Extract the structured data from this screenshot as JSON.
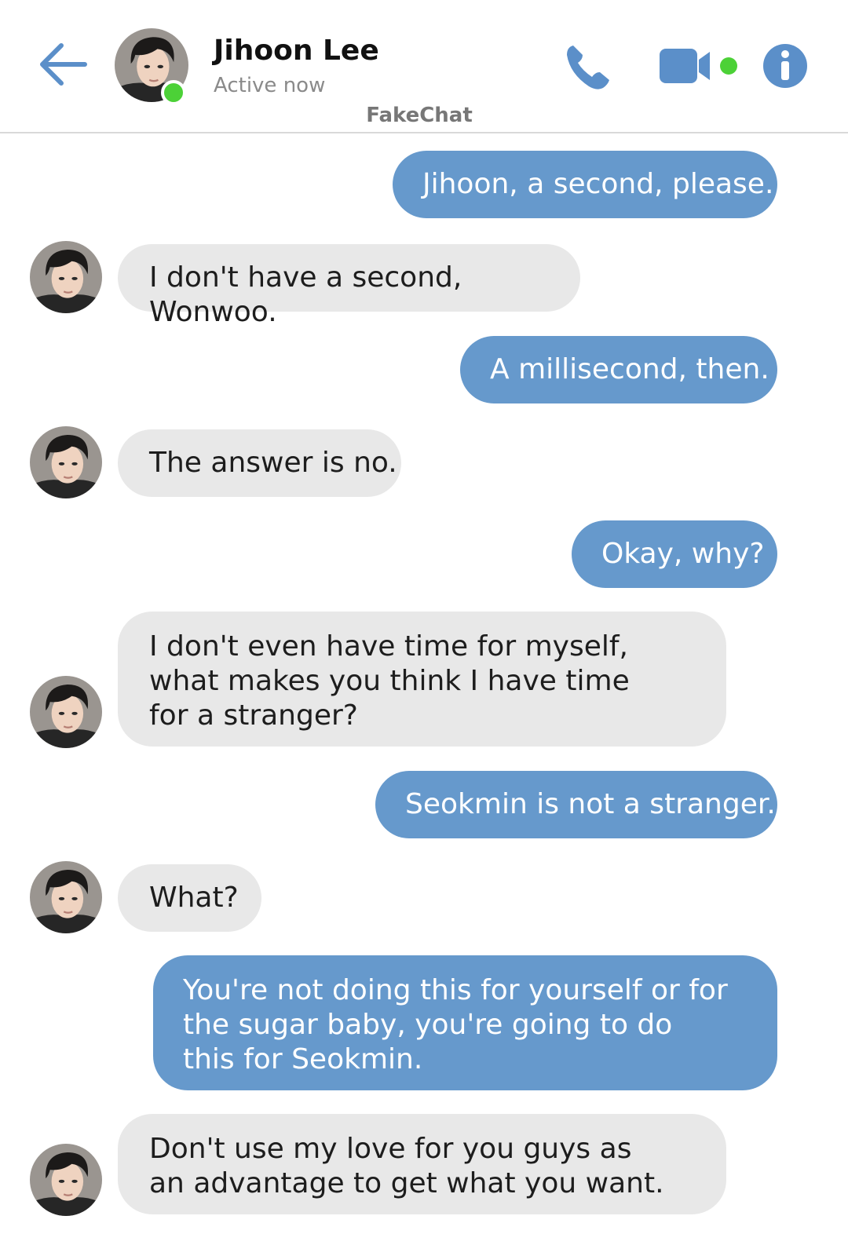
{
  "header": {
    "contact_name": "Jihoon Lee",
    "status": "Active now",
    "watermark": "FakeChat",
    "icons": {
      "back": "arrow-left-icon",
      "call": "phone-icon",
      "video": "video-camera-icon",
      "info": "info-icon"
    },
    "colors": {
      "accent": "#5b8fc9",
      "online": "#4cd137"
    }
  },
  "messages": [
    {
      "from": "me",
      "text": "Jihoon, a second, please."
    },
    {
      "from": "contact",
      "text": "I don't have a second, Wonwoo."
    },
    {
      "from": "me",
      "text": "A millisecond, then."
    },
    {
      "from": "contact",
      "text": "The answer is no."
    },
    {
      "from": "me",
      "text": "Okay, why?"
    },
    {
      "from": "contact",
      "text": "I don't even have time for myself, what makes you think I have time for a stranger?"
    },
    {
      "from": "me",
      "text": "Seokmin is not a stranger."
    },
    {
      "from": "contact",
      "text": "What?"
    },
    {
      "from": "me",
      "text": "You're not doing this for yourself or for the sugar baby, you're going to do this for Seokmin."
    },
    {
      "from": "contact",
      "text": "Don't use my love for you guys as an advantage to get what you want."
    }
  ],
  "colors": {
    "sent_bubble": "#6699cc",
    "received_bubble": "#e8e8e8"
  }
}
